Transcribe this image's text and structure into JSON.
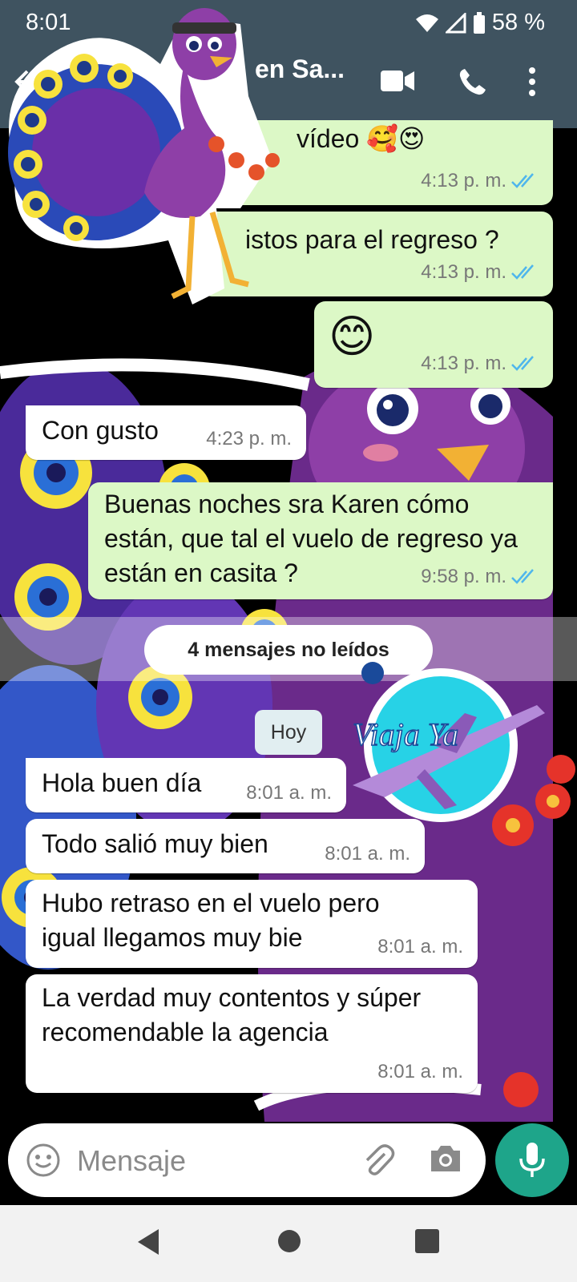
{
  "status_bar": {
    "time": "8:01",
    "battery": "58 %"
  },
  "app_bar": {
    "title": "en Sa..."
  },
  "messages": [
    {
      "text": "vídeo 🥰😍",
      "time": "4:13 p. m."
    },
    {
      "text": "istos para el regreso ?",
      "time": "4:13 p. m."
    },
    {
      "text": "😊",
      "time": "4:13 p. m."
    },
    {
      "text": "Con gusto",
      "time": "4:23 p. m."
    },
    {
      "text": "Buenas noches sra Karen cómo están, que tal el vuelo de regreso ya están en casita ?",
      "time": "9:58 p. m."
    },
    {
      "text": "Hola buen día",
      "time": "8:01 a. m."
    },
    {
      "text": "Todo salió muy bien",
      "time": "8:01 a. m."
    },
    {
      "text": "Hubo retraso en el vuelo pero igual llegamos muy bie",
      "time": "8:01 a. m."
    },
    {
      "text": "La verdad muy contentos y súper recomendable la agencia",
      "time": "8:01 a. m."
    }
  ],
  "unread_banner": "4 mensajes no leídos",
  "date_chip": "Hoy",
  "logo_text": "Viaja Ya",
  "input": {
    "placeholder": "Mensaje"
  },
  "colors": {
    "app_bar": "#3f5360",
    "outgoing_bubble": "#dcf8c6",
    "incoming_bubble": "#ffffff",
    "mic_button": "#1ea58a",
    "read_ticks": "#4fb6ec"
  },
  "icons": [
    "back-arrow-icon",
    "video-call-icon",
    "phone-icon",
    "more-vert-icon",
    "wifi-icon",
    "signal-icon",
    "battery-icon",
    "read-ticks-icon",
    "emoji-icon",
    "attach-icon",
    "camera-icon",
    "mic-icon",
    "nav-back-icon",
    "nav-home-icon",
    "nav-recent-icon"
  ]
}
